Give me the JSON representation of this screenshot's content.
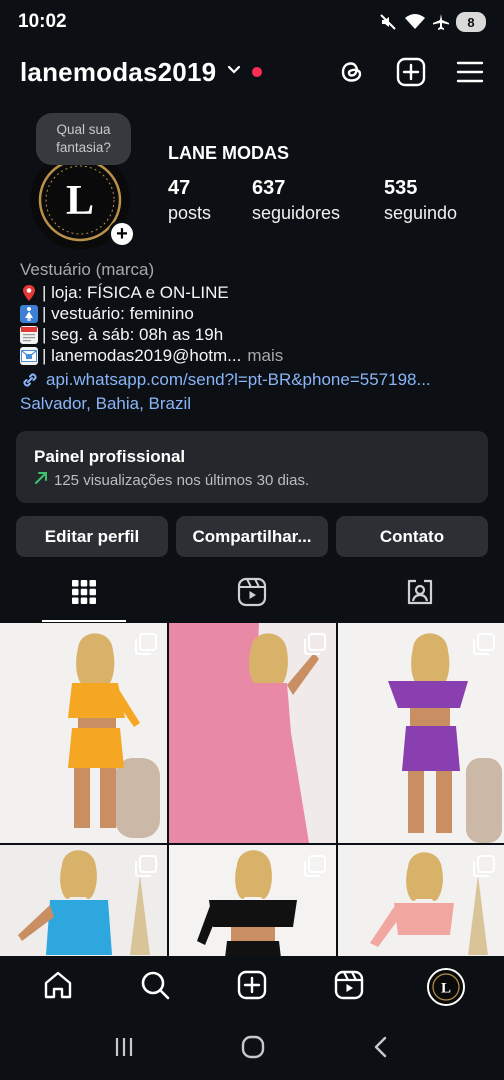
{
  "status_bar": {
    "time": "10:02",
    "battery": "8",
    "icons": [
      "mute-icon",
      "wifi-icon",
      "airplane-icon",
      "battery-icon"
    ]
  },
  "header": {
    "username": "lanemodas2019",
    "icons": [
      "chevron-down-icon",
      "notification-dot",
      "threads-icon",
      "create-plus-icon",
      "menu-icon"
    ],
    "dot_color": "#ff2d55"
  },
  "profile": {
    "note": "Qual sua fantasia?",
    "avatar_letter": "L",
    "display_name": "LANE MODAS",
    "stats": [
      {
        "value": "47",
        "label": "posts"
      },
      {
        "value": "637",
        "label": "seguidores"
      },
      {
        "value": "535",
        "label": "seguindo"
      }
    ]
  },
  "bio": {
    "category": "Vestuário (marca)",
    "lines": [
      {
        "icon": "pin-icon",
        "text": "| loja: FÍSICA e ON-LINE"
      },
      {
        "icon": "womens-icon",
        "text": "| vestuário: feminino"
      },
      {
        "icon": "calendar-icon",
        "text": "| seg. à sáb: 08h as 19h"
      },
      {
        "icon": "email-icon",
        "text": "| lanemodas2019@hotm..."
      }
    ],
    "more": "mais",
    "link": "api.whatsapp.com/send?l=pt-BR&phone=557198...",
    "location": "Salvador, Bahia, Brazil"
  },
  "pro_panel": {
    "title": "Painel profissional",
    "subtitle": "125 visualizações nos últimos 30 dias."
  },
  "buttons": {
    "edit": "Editar perfil",
    "share": "Compartilhar...",
    "contact": "Contato"
  },
  "tabs": [
    "grid-icon",
    "reels-icon",
    "tagged-icon"
  ],
  "posts": [
    {
      "bg": "#f2f1ef",
      "outfit": "#f5a623"
    },
    {
      "bg": "#e89ab2",
      "outfit": "#e88aa6"
    },
    {
      "bg": "#f3f2f0",
      "outfit": "#8a3fb0"
    },
    {
      "bg": "#eeedeb",
      "outfit": "#2ea6de"
    },
    {
      "bg": "#f4f3f1",
      "outfit": "#111111"
    },
    {
      "bg": "#f2f1ef",
      "outfit": "#f2a6a0"
    }
  ],
  "bottom_nav": [
    "home-icon",
    "search-icon",
    "create-icon",
    "reels-icon",
    "profile-avatar"
  ],
  "system_nav": [
    "recents-icon",
    "home-button-icon",
    "back-icon"
  ],
  "colors": {
    "background": "#0c1014",
    "link": "#8ab4f8",
    "button": "#2c3035",
    "panel": "#24282d",
    "trend_green": "#3ec46d"
  }
}
